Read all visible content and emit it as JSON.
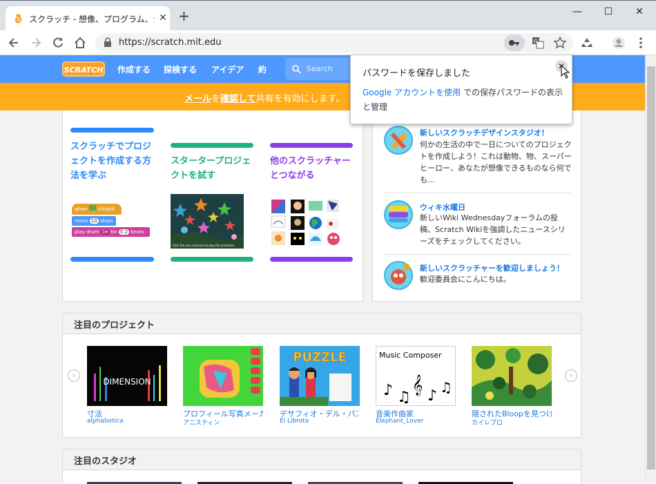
{
  "browser": {
    "tab_title": "スクラッチ - 想像、プログラム、シェア",
    "tab_close": "✕",
    "new_tab": "+",
    "url": "https://scratch.mit.edu",
    "window_min": "—",
    "window_max": "☐",
    "window_close": "✕"
  },
  "scratch_nav": {
    "logo": "SCRATCH",
    "items": [
      "作成する",
      "探検する",
      "アイデア",
      "約"
    ],
    "search_placeholder": "Search"
  },
  "banner": {
    "link1": "メール",
    "mid": "を",
    "link2": "確認して",
    "rest": "共有を有効にします。"
  },
  "getting_started": [
    {
      "title": "スクラッチでプロジェクトを作成する方法を学ぶ",
      "color": "#2b8af7"
    },
    {
      "title": "スタータープロジェクトを試す",
      "color": "#1cb37b"
    },
    {
      "title": "他のスクラッチャーとつながる",
      "color": "#8a3de8"
    }
  ],
  "code_blocks": {
    "when": "when",
    "clicked": "clicked",
    "move": "move",
    "move_val": "10",
    "steps": "steps",
    "play": "play drum",
    "drum": "1▾",
    "for": "for",
    "beats_val": "0.2",
    "beats": "beats"
  },
  "starter_caption": "Click the sea creatures to play the orchestra",
  "news": [
    {
      "title": "新しいスクラッチデザインスタジオ！",
      "text": "何かの生活の中で一日についてのプロジェクトを作成しよう！これは動物、物、スーパーヒーロー、あなたが想像できるものなら何でも..."
    },
    {
      "title": "ウィキ水曜日",
      "text": "新しいWiki Wednesdayフォーラムの投稿、Scratch Wikiを強調したニュースシリーズをチェックしてください。"
    },
    {
      "title": "新しいスクラッチャーを歓迎しましょう！",
      "text": "歓迎委員会にこんにちは。"
    }
  ],
  "featured_projects": {
    "heading": "注目のプロジェクト",
    "items": [
      {
        "title": "寸法",
        "author": "alphabetica",
        "thumb_text": "DIMENSION"
      },
      {
        "title": "プロフィール写真メーカー",
        "author": "アニスティン",
        "thumb_text": ""
      },
      {
        "title": "デサフィオ・デル・パズル",
        "author": "El Librote",
        "thumb_text": "PUZZLE"
      },
      {
        "title": "音楽作曲家",
        "author": "Elephant_Lover",
        "thumb_text": "Music Composer"
      },
      {
        "title": "隠されたBloopを見つける",
        "author": "カイレプロ",
        "thumb_text": ""
      }
    ]
  },
  "featured_studios": {
    "heading": "注目のスタジオ"
  },
  "password_popup": {
    "title": "パスワードを保存しました",
    "link": "Google アカウントを使用",
    "body": "での保存パスワードの表示と管理",
    "close": "✕"
  },
  "colors": {
    "scratch_blue": "#4d97ff",
    "banner_orange": "#ffab1a",
    "link_blue": "#1a7be0"
  }
}
